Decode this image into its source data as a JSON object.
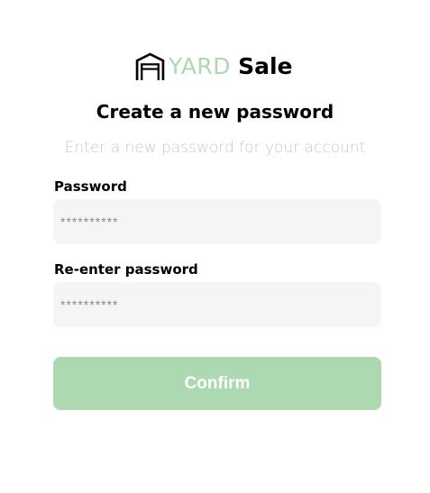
{
  "logo": {
    "icon": "garage-icon",
    "word_yard": "YARD",
    "word_sale": "Sale"
  },
  "page_title": "Create a new password",
  "page_subtitle": "Enter a new password for your account",
  "form": {
    "password": {
      "label": "Password",
      "placeholder": "**********"
    },
    "repeat_password": {
      "label": "Re-enter password",
      "placeholder": "**********"
    },
    "confirm_label": "Confirm"
  },
  "colors": {
    "accent_green": "#acd9b1",
    "input_background": "#f5f5f5",
    "subtitle_gray": "#c8c8c8",
    "text_black": "#000000"
  }
}
